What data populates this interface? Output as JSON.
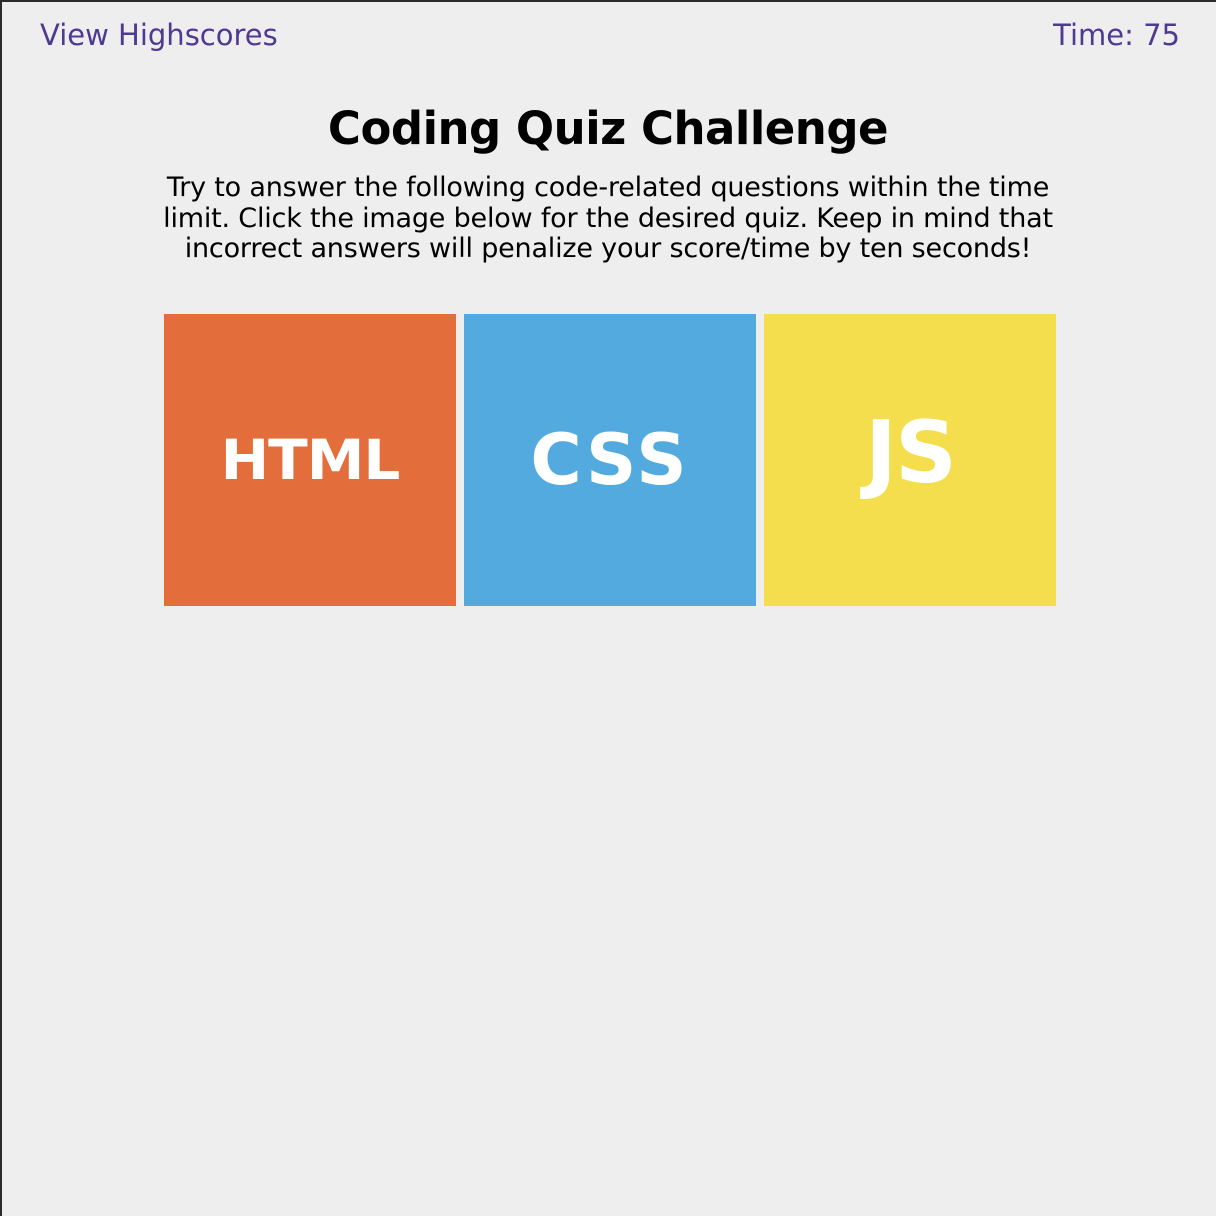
{
  "header": {
    "highscores_label": "View Highscores",
    "timer_label": "Time: 75"
  },
  "intro": {
    "title": "Coding Quiz Challenge",
    "instructions": "Try to answer the following code-related questions within the time limit. Click the image below for the desired quiz. Keep in mind that incorrect answers will penalize your score/time by ten seconds!"
  },
  "quizzes": [
    {
      "label": "HTML",
      "color": "#e36d3b"
    },
    {
      "label": "CSS",
      "color": "#52aade"
    },
    {
      "label": "JS",
      "color": "#f4de4e"
    }
  ],
  "colors": {
    "background": "#eeeeee",
    "link": "#4f3a91",
    "tile_text": "#ffffff"
  }
}
